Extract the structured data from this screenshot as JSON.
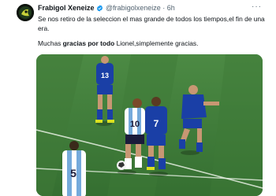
{
  "tweet": {
    "display_name": "Frabigol Xeneize",
    "handle": "@frabigolxeneize",
    "separator": "·",
    "timestamp": "6h",
    "text": "Se nos retiro de la seleccion el mas grande de todos los tiempos,el fin de una era.",
    "line2_before": "Muchas ",
    "line2_bold": "gracias por todo",
    "line2_after": " Lionel,simplemente gracias.",
    "more_label": "···"
  },
  "icons": {
    "avatar": "avatar-logo-icon",
    "verified": "verified-badge-icon",
    "more": "more-icon"
  },
  "colors": {
    "name": "#0f1419",
    "muted": "#536471",
    "verified": "#1d9bf0",
    "pitch": "#3f7d3a",
    "bosnia_blue": "#1a3fa6",
    "argentina_sky": "#75aadb"
  },
  "media": {
    "description_free": true,
    "shirt_numbers": [
      "13",
      "10",
      "7",
      "5"
    ]
  }
}
